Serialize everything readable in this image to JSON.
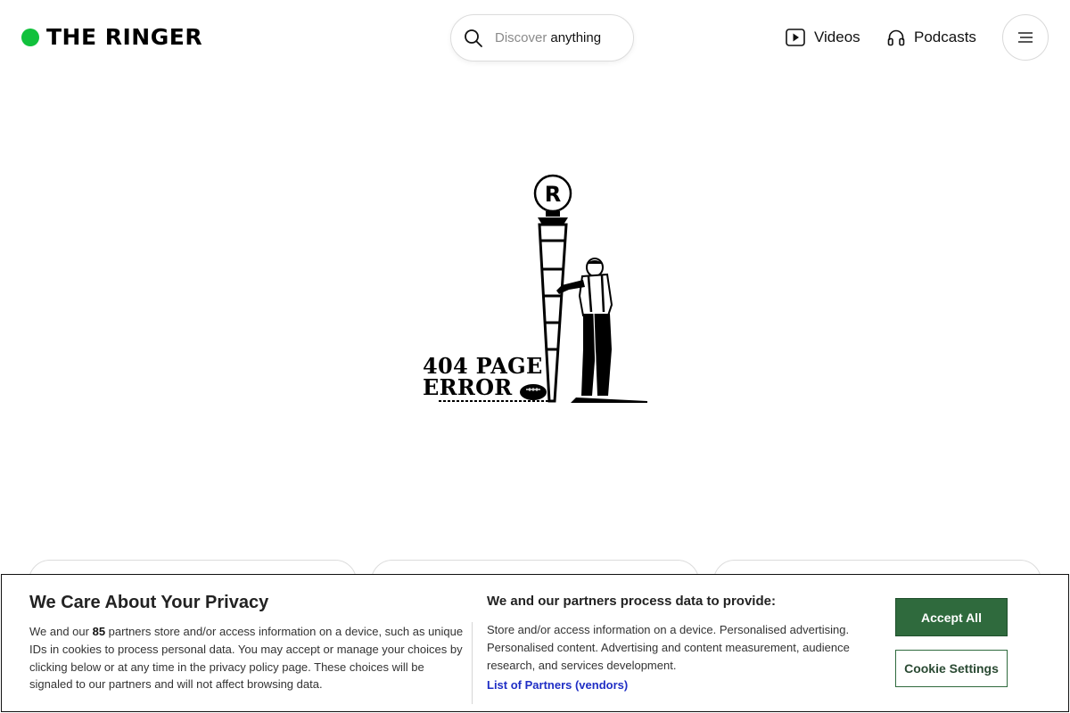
{
  "header": {
    "logo_text": "THE RINGER",
    "search": {
      "placeholder": "Discover",
      "typed": "anything"
    },
    "nav": [
      {
        "label": "Videos",
        "icon": "play-square-icon"
      },
      {
        "label": "Podcasts",
        "icon": "headphones-icon"
      }
    ],
    "menu_icon": "hamburger-menu-icon"
  },
  "illustration": {
    "badge": "R",
    "error_line1": "404 PAGE",
    "error_line2": "ERROR"
  },
  "cookie_banner": {
    "title": "We Care About Your Privacy",
    "left_text_before_count": "We and our ",
    "partner_count": "85",
    "left_text_after_count": " partners store and/or access information on a device, such as unique IDs in cookies to process personal data. You may accept or manage your choices by clicking below or at any time in the privacy policy page. These choices will be signaled to our partners and will not affect browsing data.",
    "right_title": "We and our partners process data to provide:",
    "right_text": "Store and/or access information on a device. Personalised advertising. Personalised content. Advertising and content measurement, audience research, and services development.",
    "partners_link": "List of Partners (vendors)",
    "accept_label": "Accept All",
    "settings_label": "Cookie Settings"
  },
  "colors": {
    "brand_green": "#11c13c",
    "accept_green": "#2f6a3d",
    "link_blue": "#1f2ec5"
  }
}
